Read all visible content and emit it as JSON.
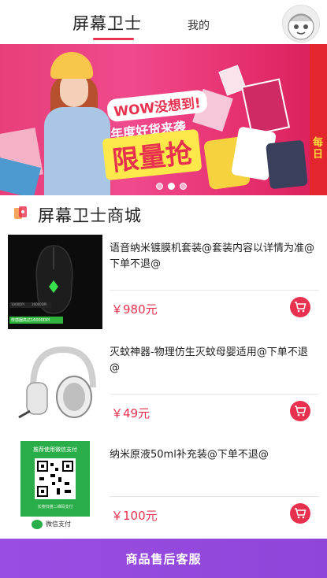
{
  "header": {
    "tab_active": "屏幕卫士",
    "tab_mine": "我的",
    "avatar_icon": "cartoon-avatar-icon"
  },
  "banner": {
    "wow_text": "WOW没想到!",
    "sub_text": "年度好货来袭",
    "main_text": "限量抢",
    "side_text": "每日",
    "slide_count": 3,
    "active_slide": 2
  },
  "section": {
    "title": "屏幕卫士商城",
    "icon": "mall-icon"
  },
  "products": [
    {
      "title": "语音纳米镀膜机套装@套装内容以详情为准@下单不退@",
      "price": "￥980元",
      "image": "gaming-mouse-image",
      "image_text": [
        "1000DPI",
        "16000DPI",
        "传感器高达16000DPI"
      ]
    },
    {
      "title": "灭蚊神器-物理仿生灭蚊母婴适用@下单不退@",
      "price": "￥49元",
      "image": "headphones-image"
    },
    {
      "title": "纳米原液50ml补充装@下单不退@",
      "price": "￥100元",
      "image": "wechat-pay-qr-image",
      "image_text": [
        "推荐使用微信支付",
        "长按扫描二维码支付",
        "微信支付"
      ]
    }
  ],
  "bottom_bar": {
    "label": "商品售后客服"
  },
  "colors": {
    "accent": "#e8304f",
    "bottom_bar": "#9a4de2"
  }
}
